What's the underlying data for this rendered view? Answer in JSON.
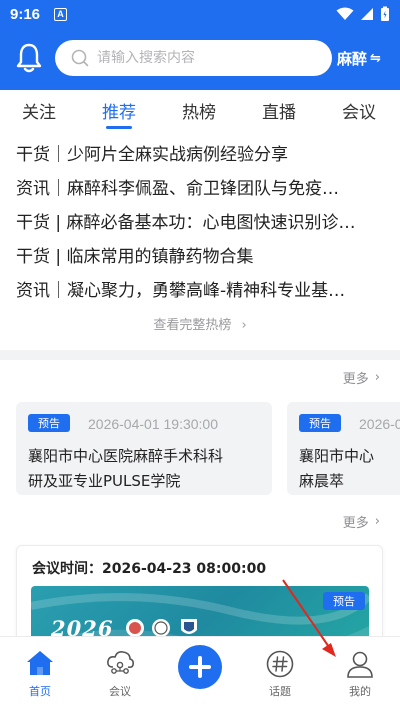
{
  "status_bar": {
    "time": "9:16",
    "notif_letter": "A"
  },
  "header": {
    "search_placeholder": "请输入搜索内容",
    "department": "麻醉",
    "department_switch": "⇋"
  },
  "tabs": [
    {
      "label": "关注",
      "active": false
    },
    {
      "label": "推荐",
      "active": true
    },
    {
      "label": "热榜",
      "active": false
    },
    {
      "label": "直播",
      "active": false
    },
    {
      "label": "会议",
      "active": false
    }
  ],
  "hot_list": {
    "items": [
      "干货｜少阿片全麻实战病例经验分享",
      "资讯｜麻醉科李佩盈、俞卫锋团队与免疫…",
      "干货 | 麻醉必备基本功：心电图快速识别诊…",
      "干货 | 临床常用的镇静药物合集",
      "资讯｜凝心聚力，勇攀高峰-精神科专业基…"
    ],
    "view_full": "查看完整热榜"
  },
  "preview_section": {
    "more": "更多",
    "cards": [
      {
        "badge": "预告",
        "time": "2026-04-01 19:30:00",
        "title_line1": "襄阳市中心医院麻醉手术科科",
        "title_line2": "研及亚专业PULSE学院"
      },
      {
        "badge": "预告",
        "time": "2026-0",
        "title_line1": "襄阳市中心",
        "title_line2": "麻晨萃"
      }
    ]
  },
  "meeting_section": {
    "more": "更多",
    "time_label": "会议时间：2026-04-23 08:00:00",
    "badge": "预告",
    "banner_year": "2026"
  },
  "bottom_nav": [
    {
      "label": "首页",
      "icon": "home-icon",
      "active": true
    },
    {
      "label": "会议",
      "icon": "cloud-people-icon",
      "active": false
    },
    {
      "label": "",
      "icon": "plus-icon",
      "active": false
    },
    {
      "label": "话题",
      "icon": "hashtag-icon",
      "active": false
    },
    {
      "label": "我的",
      "icon": "person-icon",
      "active": false
    }
  ],
  "colors": {
    "brand": "#1f6ef0",
    "annotation_arrow": "#e0281e"
  }
}
